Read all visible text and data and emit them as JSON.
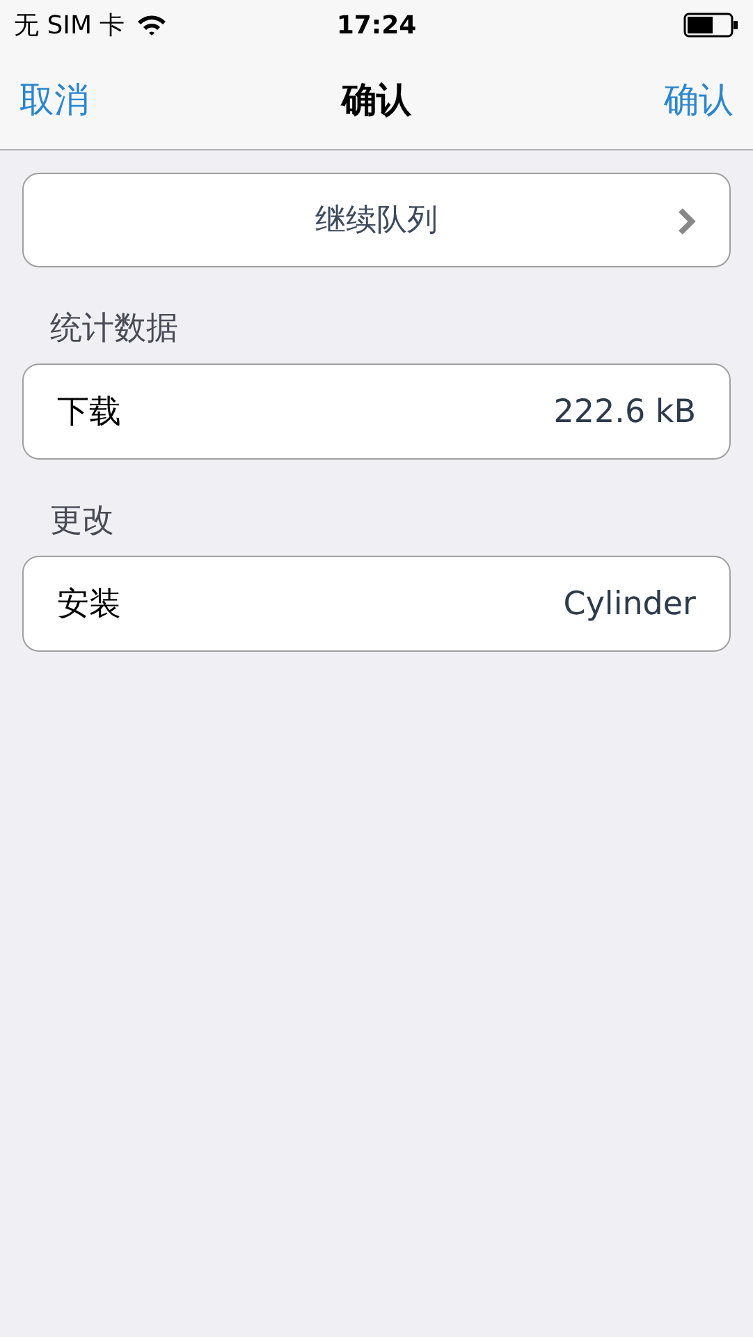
{
  "status_bar": {
    "carrier": "无 SIM 卡",
    "time": "17:24"
  },
  "nav": {
    "cancel": "取消",
    "title": "确认",
    "confirm": "确认"
  },
  "queue_button": {
    "label": "继续队列"
  },
  "sections": [
    {
      "header": "统计数据",
      "rows": [
        {
          "label": "下载",
          "value": "222.6 kB"
        }
      ]
    },
    {
      "header": "更改",
      "rows": [
        {
          "label": "安装",
          "value": "Cylinder"
        }
      ]
    }
  ]
}
